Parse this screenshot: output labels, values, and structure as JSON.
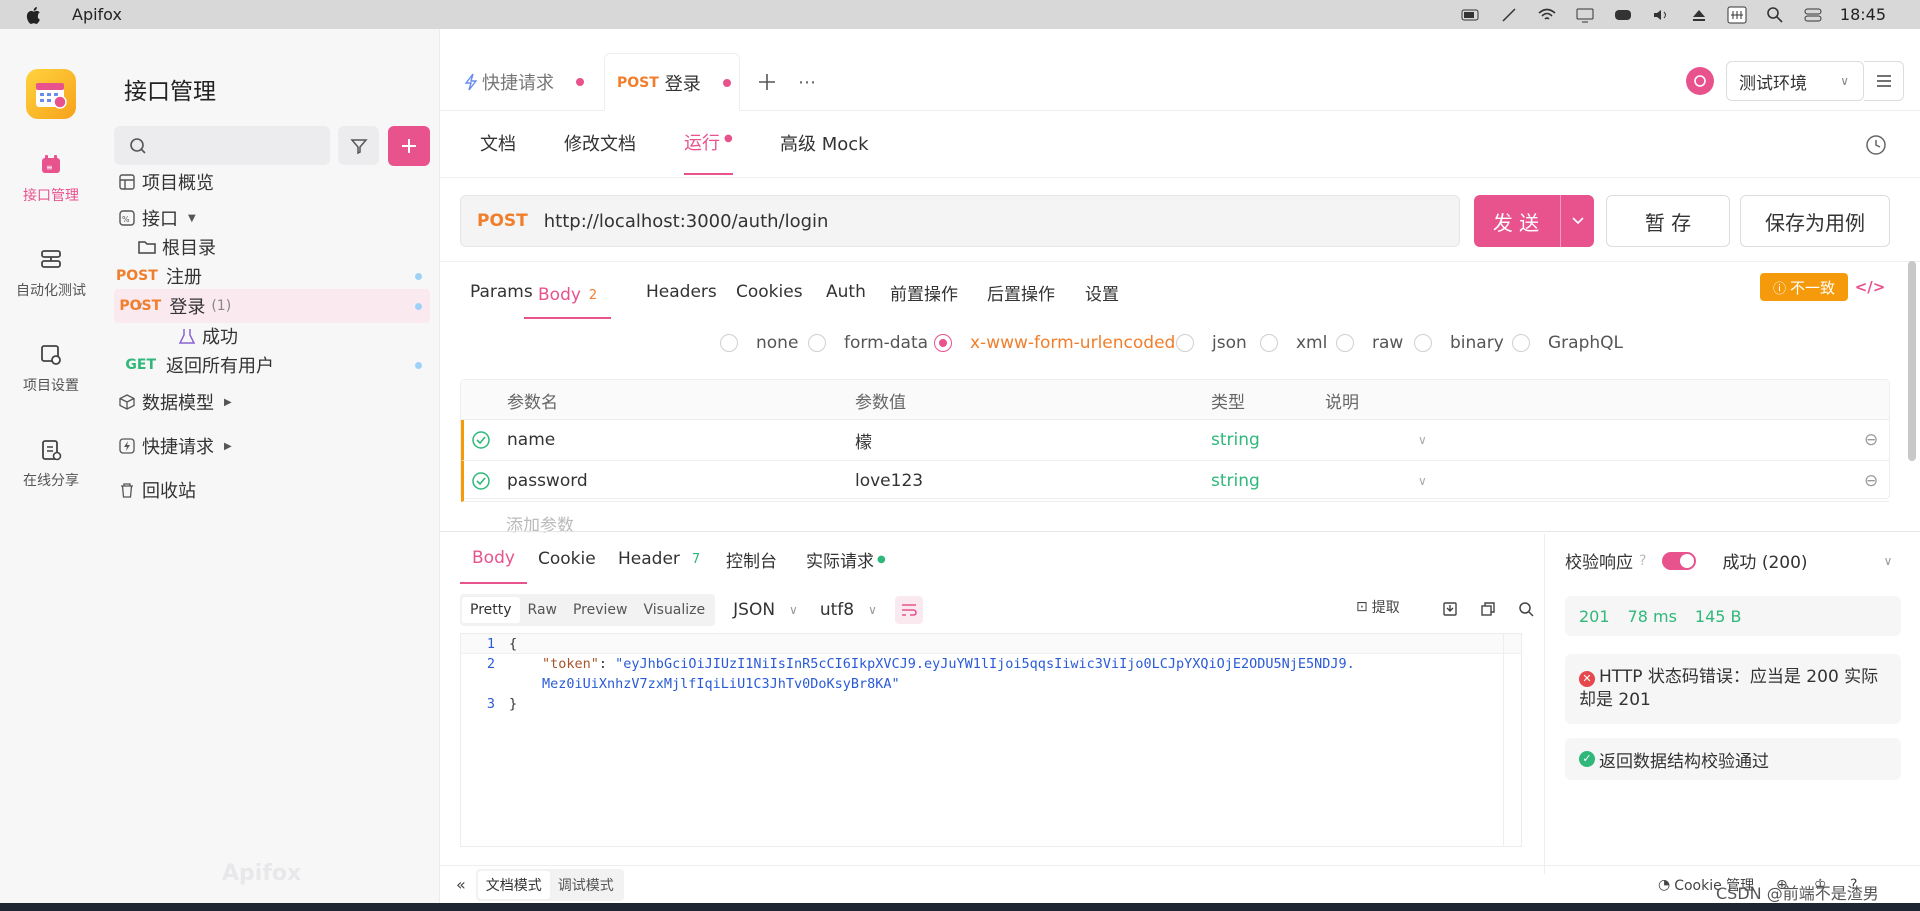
{
  "menubar": {
    "app_name": "Apifox",
    "clock": "18:45"
  },
  "rail": {
    "items": [
      {
        "label": "接口管理",
        "icon": "api-icon"
      },
      {
        "label": "自动化测试",
        "icon": "automation-icon"
      },
      {
        "label": "项目设置",
        "icon": "settings-icon"
      },
      {
        "label": "在线分享",
        "icon": "share-icon"
      }
    ]
  },
  "sidebar": {
    "title": "接口管理",
    "tree": [
      {
        "label": "项目概览"
      },
      {
        "label": "接口"
      },
      {
        "label": "根目录"
      },
      {
        "method": "POST",
        "label": "注册"
      },
      {
        "method": "POST",
        "label": "登录",
        "count": "(1)"
      },
      {
        "label": "成功"
      },
      {
        "method": "GET",
        "label": "返回所有用户"
      },
      {
        "label": "数据模型"
      },
      {
        "label": "快捷请求"
      },
      {
        "label": "回收站"
      }
    ],
    "watermark": "Apifox"
  },
  "top_tabs": [
    {
      "label": "快捷请求"
    },
    {
      "method": "POST",
      "label": "登录"
    }
  ],
  "env": {
    "label": "测试环境"
  },
  "sub_tabs": [
    "文档",
    "修改文档",
    "运行",
    "高级 Mock"
  ],
  "request": {
    "method": "POST",
    "url": "http://localhost:3000/auth/login",
    "send_label": "发 送",
    "save_label": "暂 存",
    "save_case_label": "保存为用例"
  },
  "req_tabs": [
    "Params",
    "Body",
    "Headers",
    "Cookies",
    "Auth",
    "前置操作",
    "后置操作",
    "设置"
  ],
  "body_count": "2",
  "mismatch_label": "不一致",
  "body_types": [
    "none",
    "form-data",
    "x-www-form-urlencoded",
    "json",
    "xml",
    "raw",
    "binary",
    "GraphQL"
  ],
  "params_table": {
    "headers": [
      "参数名",
      "参数值",
      "类型",
      "说明"
    ],
    "rows": [
      {
        "name": "name",
        "value": "檬",
        "type": "string"
      },
      {
        "name": "password",
        "value": "love123",
        "type": "string"
      }
    ],
    "add_placeholder": "添加参数"
  },
  "resp_tabs": [
    "Body",
    "Cookie",
    "Header",
    "控制台",
    "实际请求"
  ],
  "header_count": "7",
  "format_bar": {
    "views": [
      "Pretty",
      "Raw",
      "Preview",
      "Visualize"
    ],
    "format": "JSON",
    "encoding": "utf8",
    "extract_label": "提取"
  },
  "code": {
    "l1": "{",
    "key": "\"token\"",
    "val1": "\"eyJhbGciOiJIUzI1NiIsInR5cCI6IkpXVCJ9.eyJuYW1lIjoi5qqsIiwic3ViIjo0LCJpYXQiOjE2ODU5NjE5NDJ9.",
    "val2": "Mez0iUiXnhzV7zxMjlfIqiLiU1C3JhTv0DoKsyBr8KA\"",
    "l3": "}"
  },
  "verify": {
    "label": "校验响应",
    "status": "成功 (200)",
    "stats": {
      "code": "201",
      "time": "78 ms",
      "size": "145 B"
    },
    "error_msg": "HTTP 状态码错误：应当是 200 实际却是 201",
    "ok_msg": "返回数据结构校验通过"
  },
  "footer": {
    "doc_mode": "文档模式",
    "debug_mode": "调试模式",
    "cookie_label": "Cookie 管理",
    "csdn": "CSDN @前端不是渣男"
  },
  "colors": {
    "accent": "#e8528d",
    "post": "#f07e2b",
    "get": "#2fb87a",
    "warn": "#f59a0b"
  }
}
